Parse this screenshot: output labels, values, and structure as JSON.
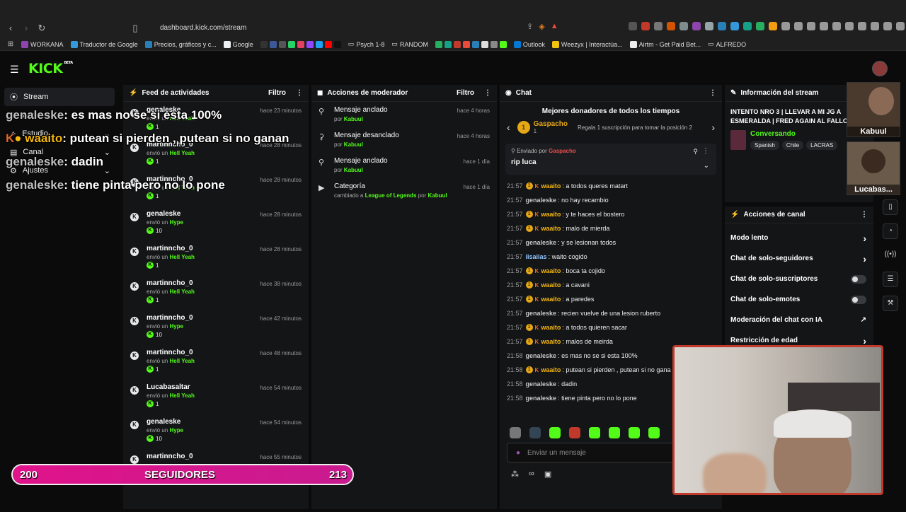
{
  "browser": {
    "url": "dashboard.kick.com/stream",
    "bookmarks": [
      "WORKANA",
      "Traductor de Google",
      "Precios, gráficos y c...",
      "Google",
      "Psych 1-8",
      "RANDOM",
      "Outlook",
      "Weezyx | Interactúa...",
      "Airtm - Get Paid Bet...",
      "ALFREDO"
    ]
  },
  "app": {
    "logo": "KICK",
    "logo_tag": "BETA"
  },
  "sidebar": {
    "items": [
      "Stream",
      "Logros",
      "Estudio",
      "Canal",
      "Ajustes"
    ]
  },
  "feed": {
    "title": "Feed de actividades",
    "filter": "Filtro",
    "items": [
      {
        "name": "genaleske",
        "action": "envió un",
        "item": "Hell Yeah",
        "amount": "1",
        "time": "hace 23 minutos"
      },
      {
        "name": "martinncho_0",
        "action": "envió un",
        "item": "Hell Yeah",
        "amount": "1",
        "time": "hace 28 minutos"
      },
      {
        "name": "martinncho_0",
        "action": "envió un",
        "item": "Hell Yeah",
        "amount": "1",
        "time": "hace 28 minutos"
      },
      {
        "name": "genaleske",
        "action": "envió un",
        "item": "Hype",
        "amount": "10",
        "time": "hace 28 minutos"
      },
      {
        "name": "martinncho_0",
        "action": "envió un",
        "item": "Hell Yeah",
        "amount": "1",
        "time": "hace 28 minutos"
      },
      {
        "name": "martinncho_0",
        "action": "envió un",
        "item": "Hell Yeah",
        "amount": "1",
        "time": "hace 38 minutos"
      },
      {
        "name": "martinncho_0",
        "action": "envió un",
        "item": "Hype",
        "amount": "10",
        "time": "hace 42 minutos"
      },
      {
        "name": "martinncho_0",
        "action": "envió un",
        "item": "Hell Yeah",
        "amount": "1",
        "time": "hace 48 minutos"
      },
      {
        "name": "Lucabasaltar",
        "action": "envió un",
        "item": "Hell Yeah",
        "amount": "1",
        "time": "hace 54 minutos"
      },
      {
        "name": "genaleske",
        "action": "envió un",
        "item": "Hype",
        "amount": "10",
        "time": "hace 54 minutos"
      },
      {
        "name": "martinncho_0",
        "action": "",
        "item": "",
        "amount": "",
        "time": "hace 55 minutos"
      }
    ]
  },
  "mod": {
    "title": "Acciones de moderador",
    "filter": "Filtro",
    "items": [
      {
        "title": "Mensaje anclado",
        "sub_prefix": "por",
        "by": "Kabuul",
        "time": "hace 4 horas",
        "icon": "pin-icon"
      },
      {
        "title": "Mensaje desanclado",
        "sub_prefix": "por",
        "by": "Kabuul",
        "time": "hace 4 horas",
        "icon": "unpin-icon"
      },
      {
        "title": "Mensaje anclado",
        "sub_prefix": "por",
        "by": "Kabuul",
        "time": "hace 1 día",
        "icon": "pin-icon"
      },
      {
        "title": "Categoría",
        "sub_prefix": "cambiado a",
        "cat": "League of Legends",
        "by_prefix": "por",
        "by": "Kabuul",
        "time": "hace 1 día",
        "icon": "category-icon"
      }
    ]
  },
  "chat": {
    "title": "Chat",
    "top_donors": "Mejores donadores de todos los tiempos",
    "donor_name": "Gaspacho",
    "donor_rank": "1",
    "donor_count": "1",
    "donor_hint": "Regala 1 suscripción para tomar la posición 2",
    "pinned_label": "Enviado por",
    "pinned_user": "Gaspacho",
    "pinned_msg": "rip luca",
    "messages": [
      {
        "t": "21:57",
        "badges": true,
        "u": "waaito",
        "color": "#f5b70e",
        "m": "a todos queres matart"
      },
      {
        "t": "21:57",
        "badges": false,
        "u": "genaleske",
        "color": "#c7c7c7",
        "m": "no hay recambio"
      },
      {
        "t": "21:57",
        "badges": true,
        "u": "waaito",
        "color": "#f5b70e",
        "m": "y te haces el bostero"
      },
      {
        "t": "21:57",
        "badges": true,
        "u": "waaito",
        "color": "#f5b70e",
        "m": "malo de mierda"
      },
      {
        "t": "21:57",
        "badges": false,
        "u": "genaleske",
        "color": "#c7c7c7",
        "m": "y se lesionan todos"
      },
      {
        "t": "21:57",
        "badges": false,
        "u": "iisaiias",
        "color": "#8fc7ff",
        "m": "waito cogido"
      },
      {
        "t": "21:57",
        "badges": true,
        "u": "waaito",
        "color": "#f5b70e",
        "m": "boca ta cojido"
      },
      {
        "t": "21:57",
        "badges": true,
        "u": "waaito",
        "color": "#f5b70e",
        "m": "a cavani"
      },
      {
        "t": "21:57",
        "badges": true,
        "u": "waaito",
        "color": "#f5b70e",
        "m": "a paredes"
      },
      {
        "t": "21:57",
        "badges": false,
        "u": "genaleske",
        "color": "#c7c7c7",
        "m": "recien vuelve de una lesion ruberto"
      },
      {
        "t": "21:57",
        "badges": true,
        "u": "waaito",
        "color": "#f5b70e",
        "m": "a todos quieren sacar"
      },
      {
        "t": "21:57",
        "badges": true,
        "u": "waaito",
        "color": "#f5b70e",
        "m": "malos de meirda"
      },
      {
        "t": "21:58",
        "badges": false,
        "u": "genaleske",
        "color": "#c7c7c7",
        "m": "es mas no se si esta 100%"
      },
      {
        "t": "21:58",
        "badges": true,
        "u": "waaito",
        "color": "#f5b70e",
        "m": "putean si pierden , putean si no gana"
      },
      {
        "t": "21:58",
        "badges": false,
        "u": "genaleske",
        "color": "#c7c7c7",
        "m": "dadin"
      },
      {
        "t": "21:58",
        "badges": false,
        "u": "genaleske",
        "color": "#c7c7c7",
        "m": "tiene pinta pero no lo pone"
      }
    ],
    "input_placeholder": "Enviar un mensaje"
  },
  "info": {
    "title": "Información del stream",
    "stream_title": "INTENTO NRO 3 | LLEVAR A MI JG A ESMERALDA | FRED AGAIN AL FALLO",
    "category": "Conversando",
    "tags": [
      "Spanish",
      "Chile",
      "LACRAS"
    ]
  },
  "actions": {
    "title": "Acciones de canal",
    "items": [
      {
        "label": "Modo lento",
        "ctl": "chevron"
      },
      {
        "label": "Chat de solo-seguidores",
        "ctl": "chevron"
      },
      {
        "label": "Chat de solo-suscriptores",
        "ctl": "toggle"
      },
      {
        "label": "Chat de solo-emotes",
        "ctl": "toggle"
      },
      {
        "label": "Moderación del chat con IA",
        "ctl": "external"
      },
      {
        "label": "Restricción de edad",
        "ctl": "chevron"
      }
    ]
  },
  "overlay": {
    "lines": [
      {
        "u": "genaleske",
        "m": ": es mas no se si esta 100%",
        "badges": false
      },
      {
        "u": "waaito",
        "m": ": putean si pierden , putean si no ganan",
        "badges": true
      },
      {
        "u": "genaleske",
        "m": ": dadin",
        "badges": false
      },
      {
        "u": "genaleske",
        "m": ": tiene pinta pero no lo pone",
        "badges": false
      }
    ],
    "pip1_label": "Kabuul",
    "pip2_label": "Lucabas..."
  },
  "goal": {
    "start": "200",
    "label": "SEGUIDORES",
    "end": "213",
    "progress": 1.0
  },
  "colors": {
    "accent": "#53fc18",
    "panel": "#141517",
    "goal": "#e0138b"
  }
}
